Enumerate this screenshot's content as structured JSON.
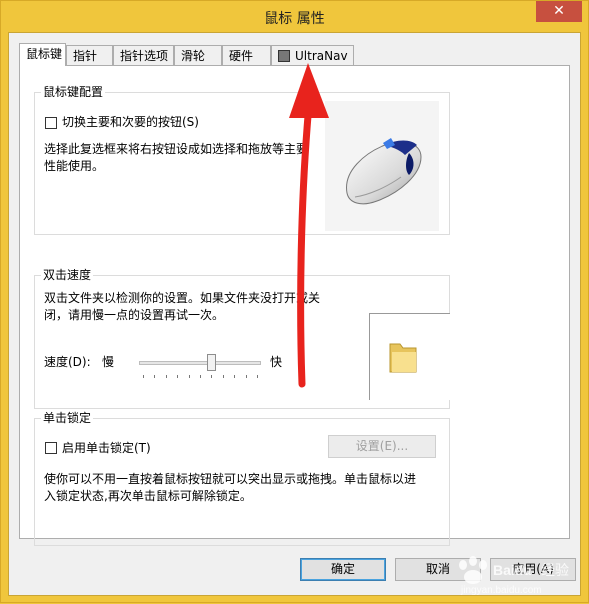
{
  "window": {
    "title": "鼠标 属性",
    "close_glyph": "✕"
  },
  "tabs": [
    {
      "label": "鼠标键",
      "active": true
    },
    {
      "label": "指针"
    },
    {
      "label": "指针选项"
    },
    {
      "label": "滑轮"
    },
    {
      "label": "硬件"
    },
    {
      "label": "UltraNav"
    }
  ],
  "button_config": {
    "title": "鼠标键配置",
    "checkbox_label": "切换主要和次要的按钮(S)",
    "checked": false,
    "description_line1": "选择此复选框来将右按钮设成如选择和拖放等主要",
    "description_line2": "性能使用。"
  },
  "double_click": {
    "title": "双击速度",
    "description_line1": "双击文件夹以检测你的设置。如果文件夹没打开或关",
    "description_line2": "闭，请用慢一点的设置再试一次。",
    "speed_label": "速度(D):",
    "slow_label": "慢",
    "fast_label": "快",
    "speed_fraction": 0.6
  },
  "click_lock": {
    "title": "单击锁定",
    "checkbox_label": "启用单击锁定(T)",
    "checked": false,
    "settings_button": "设置(E)...",
    "description_line1": "使你可以不用一直按着鼠标按钮就可以突出显示或拖拽。单击鼠标以进",
    "description_line2": "入锁定状态,再次单击鼠标可解除锁定。"
  },
  "footer": {
    "ok": "确定",
    "cancel": "取消",
    "apply": "应用(A)"
  },
  "annotation": {
    "arrow_color": "#e8231d"
  },
  "watermark": {
    "brand": "Baidu",
    "text": "经验",
    "site": "jingyan.baidu.com"
  }
}
